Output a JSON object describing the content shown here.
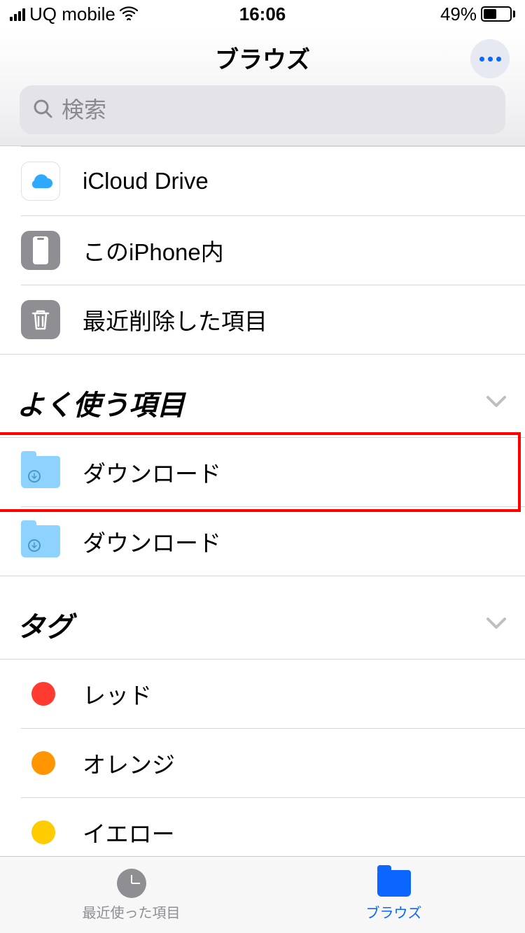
{
  "status": {
    "carrier": "UQ mobile",
    "time": "16:06",
    "battery_pct": "49%"
  },
  "header": {
    "title": "ブラウズ",
    "search_placeholder": "検索"
  },
  "locations": [
    {
      "id": "icloud",
      "label": "iCloud Drive"
    },
    {
      "id": "iphone",
      "label": "このiPhone内"
    },
    {
      "id": "trash",
      "label": "最近削除した項目"
    }
  ],
  "sections": {
    "favorites": {
      "title": "よく使う項目"
    },
    "tags": {
      "title": "タグ"
    }
  },
  "favorites": [
    {
      "label": "ダウンロード",
      "highlighted": true
    },
    {
      "label": "ダウンロード",
      "highlighted": false
    }
  ],
  "tags": [
    {
      "label": "レッド",
      "color": "#ff3b30"
    },
    {
      "label": "オレンジ",
      "color": "#ff9500"
    },
    {
      "label": "イエロー",
      "color": "#ffcc00"
    }
  ],
  "tabbar": {
    "recents": "最近使った項目",
    "browse": "ブラウズ"
  }
}
